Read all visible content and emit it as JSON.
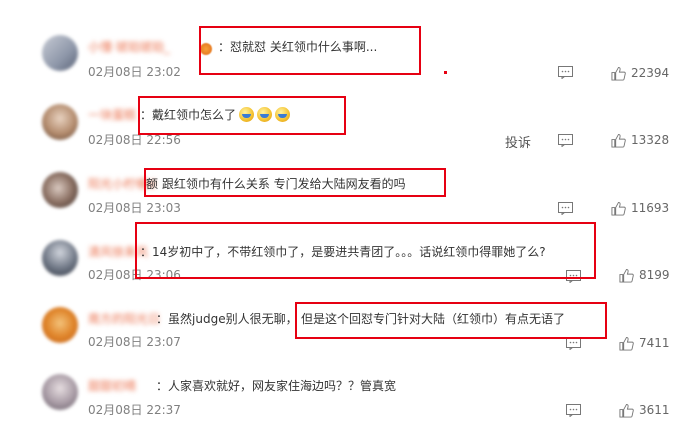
{
  "comments": [
    {
      "username": "小懂·琥珀琥珀_",
      "text": "怼就怼 关红领巾什么事啊...",
      "time": "02月08日 23:02",
      "likes": "22394"
    },
    {
      "username": "一块蛋糕",
      "text": "戴红领巾怎么了",
      "time": "02月08日 22:56",
      "likes": "13328",
      "report": "投诉"
    },
    {
      "username": "阳光小柠檬d",
      "text": "额 跟红领巾有什么关系 专门发给大陆网友看的吗",
      "time": "02月08日 23:03",
      "likes": "11693"
    },
    {
      "username": "清风徐来风",
      "text": "14岁初中了，不带红领巾了，是要进共青团了。。。话说红领巾得罪她了么?",
      "time": "02月08日 23:06",
      "likes": "8199"
    },
    {
      "username": "南方的阳光日",
      "text_a": "虽然judge别人很无聊，",
      "text_b": "但是这个回怼专门针对大陆（红领巾）有点无语了",
      "time": "02月08日 23:07",
      "likes": "7411"
    },
    {
      "username": "甜甜初晴",
      "text": "人家喜欢就好，网友家住海边吗？？管真宽",
      "time": "02月08日 22:37",
      "likes": "3611"
    }
  ],
  "colors": {
    "highlight": "#e60012",
    "username": "#eb7350"
  }
}
